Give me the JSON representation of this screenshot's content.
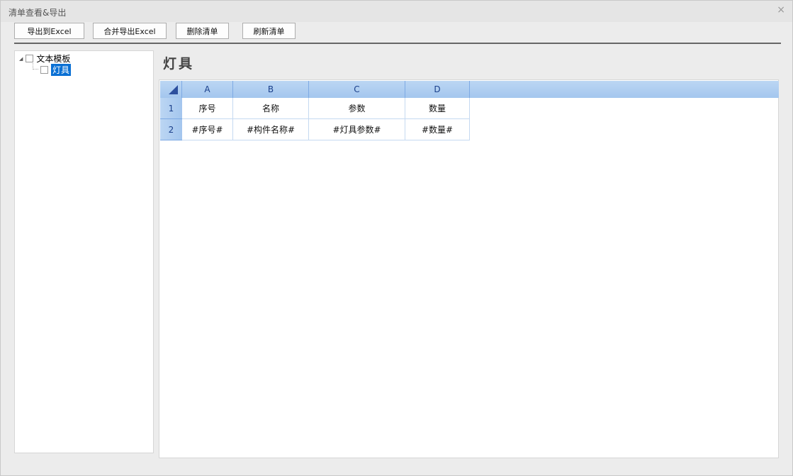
{
  "window": {
    "title": "清单查看&导出",
    "close_icon": "×"
  },
  "toolbar": {
    "export_excel": "导出到Excel",
    "merge_export_excel": "合并导出Excel",
    "delete_list": "删除清单",
    "refresh_list": "刷新清单"
  },
  "tree": {
    "root": "文本模板",
    "child": "灯具"
  },
  "content": {
    "heading": "灯具"
  },
  "grid": {
    "columns": [
      "A",
      "B",
      "C",
      "D"
    ],
    "rows": [
      {
        "num": "1",
        "cells": [
          "序号",
          "名称",
          "参数",
          "数量"
        ]
      },
      {
        "num": "2",
        "cells": [
          "#序号#",
          "#构件名称#",
          "#灯具参数#",
          "#数量#"
        ]
      }
    ]
  }
}
